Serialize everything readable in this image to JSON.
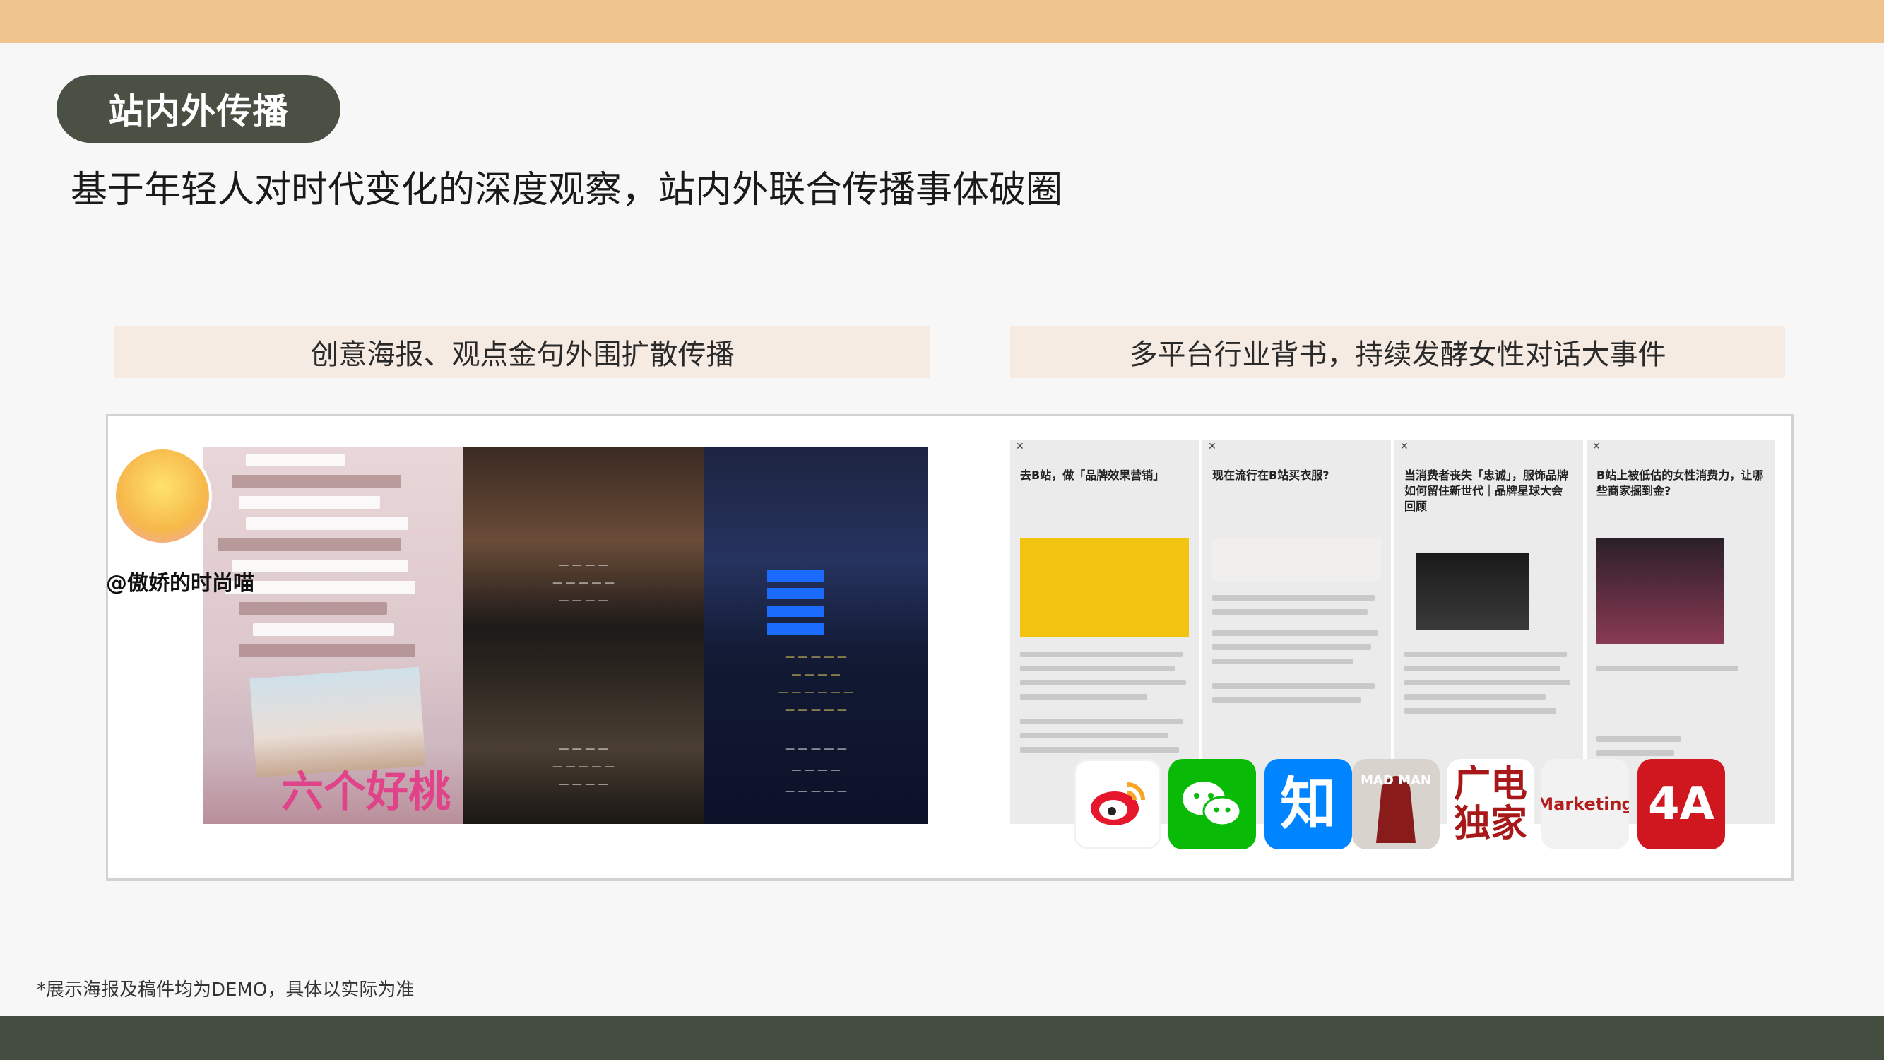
{
  "header": {
    "section_tag": "站内外传播",
    "subtitle": "基于年轻人对时代变化的深度观察，站内外联合传播事体破圈"
  },
  "sections": {
    "left_title": "创意海报、观点金句外围扩散传播",
    "right_title": "多平台行业背书，持续发酵女性对话大事件"
  },
  "left_collage": {
    "account_name": "@傲娇的时尚喵",
    "poster_title": "六个好桃",
    "poster_script": "Brisk the Road"
  },
  "article_cards": [
    {
      "title": "去B站，做「品牌效果营销」"
    },
    {
      "title": "现在流行在B站买衣服?"
    },
    {
      "title": "当消费者丧失「忠诚」，服饰品牌如何留住新世代｜品牌星球大会回顾"
    },
    {
      "title": "B站上被低估的女性消费力，让哪些商家掘到金?"
    }
  ],
  "platform_logos": [
    {
      "name": "weibo-logo",
      "label": ""
    },
    {
      "name": "wechat-logo",
      "label": ""
    },
    {
      "name": "zhihu-logo",
      "label": "知"
    },
    {
      "name": "madman-logo",
      "label": "MAD MAN"
    },
    {
      "name": "guangdian-logo",
      "label": "广电独家"
    },
    {
      "name": "marketing-logo",
      "label": "Marketing"
    },
    {
      "name": "4a-logo",
      "label": "4A"
    }
  ],
  "footnote": "*展示海报及稿件均为DEMO，具体以实际为准",
  "colors": {
    "top_band": "#f0c48e",
    "bottom_band": "#454c40",
    "pill": "#4a5044",
    "section_header_bg": "#f5ebe3"
  }
}
